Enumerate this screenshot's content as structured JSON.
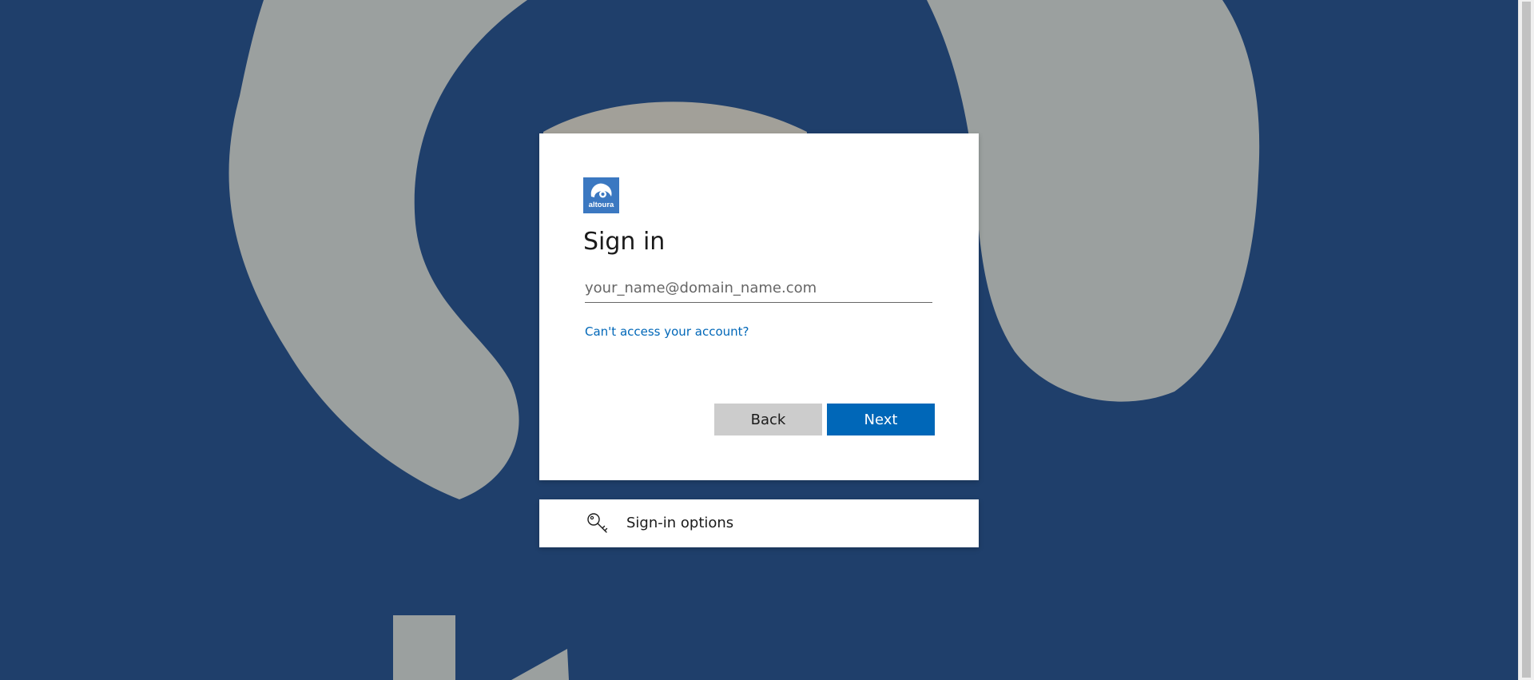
{
  "brand": {
    "logo_text": "altoura",
    "logo_color": "#3b78c1"
  },
  "signin": {
    "title": "Sign in",
    "email_placeholder": "your_name@domain_name.com",
    "email_value": "",
    "cant_access_link": "Can't access your account?",
    "back_label": "Back",
    "next_label": "Next"
  },
  "sign_in_options": {
    "icon": "key-icon",
    "label": "Sign-in options"
  },
  "colors": {
    "background": "#1f3f6b",
    "primary": "#0067b8",
    "secondary_button": "#cccccc",
    "link": "#0067b8"
  }
}
